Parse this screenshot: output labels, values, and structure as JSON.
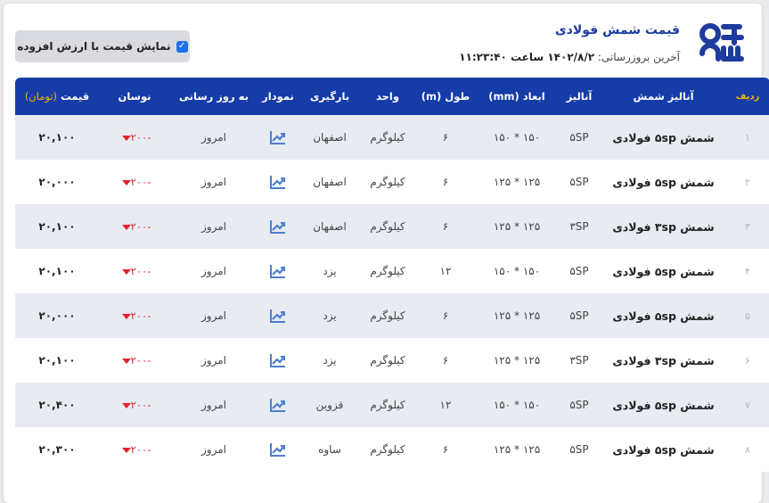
{
  "header": {
    "title": "قیمت شمش فولادی",
    "updated_label": "آخرین بروزرسانی:",
    "updated_value": "۱۴۰۲/۸/۲ ساعت ۱۱:۲۳:۴۰",
    "vat_toggle_label": "نمایش قیمت با ارزش افزوده",
    "vat_checked": true,
    "logo_icon": "brand-logo-icon"
  },
  "colors": {
    "header_bg": "#163ca7",
    "accent_yellow": "#f2b705",
    "decrease_red": "#e3222b",
    "title_blue": "#1e3c9e"
  },
  "table": {
    "columns": {
      "radif": "ردیف",
      "analysis_name": "آنالیز شمش",
      "analysis": "آنالیز",
      "dimensions": "ابعاد (mm)",
      "length": "طول (m)",
      "unit": "واحد",
      "loading": "بارگیری",
      "chart": "نمودار",
      "updated": "به روز رسانی",
      "change": "نوسان",
      "price": "قیمت",
      "price_unit": "(تومان)"
    },
    "rows": [
      {
        "idx": "۱",
        "name": "شمش ۵sp فولادی",
        "analysis": "۵SP",
        "dims": "۱۵۰ * ۱۵۰",
        "length": "۶",
        "unit": "کیلوگرم",
        "loading": "اصفهان",
        "updated": "امروز",
        "change": "-۲۰۰",
        "price": "۲۰,۱۰۰"
      },
      {
        "idx": "۲",
        "name": "شمش ۵sp فولادی",
        "analysis": "۵SP",
        "dims": "۱۲۵ * ۱۲۵",
        "length": "۶",
        "unit": "کیلوگرم",
        "loading": "اصفهان",
        "updated": "امروز",
        "change": "-۲۰۰",
        "price": "۲۰,۰۰۰"
      },
      {
        "idx": "۳",
        "name": "شمش ۳sp فولادی",
        "analysis": "۳SP",
        "dims": "۱۲۵ * ۱۲۵",
        "length": "۶",
        "unit": "کیلوگرم",
        "loading": "اصفهان",
        "updated": "امروز",
        "change": "-۲۰۰",
        "price": "۲۰,۱۰۰"
      },
      {
        "idx": "۴",
        "name": "شمش ۵sp فولادی",
        "analysis": "۵SP",
        "dims": "۱۵۰ * ۱۵۰",
        "length": "۱۲",
        "unit": "کیلوگرم",
        "loading": "یزد",
        "updated": "امروز",
        "change": "-۲۰۰",
        "price": "۲۰,۱۰۰"
      },
      {
        "idx": "۵",
        "name": "شمش ۵sp فولادی",
        "analysis": "۵SP",
        "dims": "۱۲۵ * ۱۲۵",
        "length": "۶",
        "unit": "کیلوگرم",
        "loading": "یزد",
        "updated": "امروز",
        "change": "-۲۰۰",
        "price": "۲۰,۰۰۰"
      },
      {
        "idx": "۶",
        "name": "شمش ۳sp فولادی",
        "analysis": "۳SP",
        "dims": "۱۲۵ * ۱۲۵",
        "length": "۶",
        "unit": "کیلوگرم",
        "loading": "یزد",
        "updated": "امروز",
        "change": "-۲۰۰",
        "price": "۲۰,۱۰۰"
      },
      {
        "idx": "۷",
        "name": "شمش ۵sp فولادی",
        "analysis": "۵SP",
        "dims": "۱۵۰ * ۱۵۰",
        "length": "۱۲",
        "unit": "کیلوگرم",
        "loading": "قزوین",
        "updated": "امروز",
        "change": "-۲۰۰",
        "price": "۲۰,۴۰۰"
      },
      {
        "idx": "۸",
        "name": "شمش ۵sp فولادی",
        "analysis": "۵SP",
        "dims": "۱۲۵ * ۱۲۵",
        "length": "۶",
        "unit": "کیلوگرم",
        "loading": "ساوه",
        "updated": "امروز",
        "change": "-۲۰۰",
        "price": "۲۰,۳۰۰"
      }
    ]
  }
}
